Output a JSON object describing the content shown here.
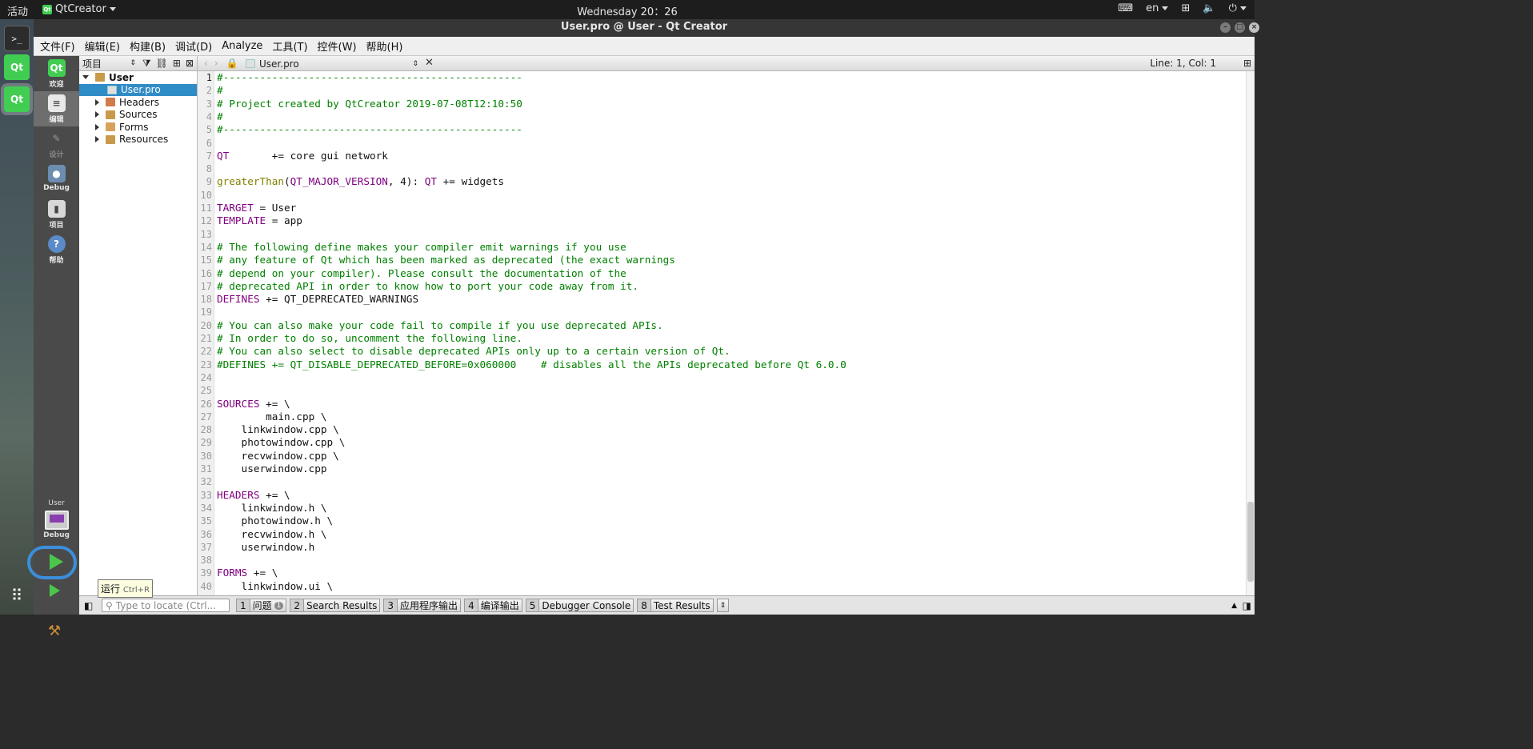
{
  "topbar": {
    "activities": "活动",
    "app_name": "QtCreator",
    "clock": "Wednesday 20：26",
    "lang": "en"
  },
  "window": {
    "title": "User.pro @ User - Qt Creator"
  },
  "menu": [
    "文件(F)",
    "编辑(E)",
    "构建(B)",
    "调试(D)",
    "Analyze",
    "工具(T)",
    "控件(W)",
    "帮助(H)"
  ],
  "modes": {
    "welcome": "欢迎",
    "edit": "编辑",
    "design": "设计",
    "debug": "Debug",
    "projects": "项目",
    "help": "帮助"
  },
  "kit": {
    "project": "User",
    "config": "Debug"
  },
  "tooltip": {
    "label": "运行",
    "shortcut": "Ctrl+R"
  },
  "project_pane": {
    "title": "项目",
    "root": "User",
    "items": [
      "User.pro",
      "Headers",
      "Sources",
      "Forms",
      "Resources"
    ]
  },
  "editor": {
    "file": "User.pro",
    "position": "Line: 1, Col: 1"
  },
  "code_lines": [
    "#-------------------------------------------------",
    "#",
    "# Project created by QtCreator 2019-07-08T12:10:50",
    "#",
    "#-------------------------------------------------",
    "",
    "QT       += core gui network",
    "",
    "greaterThan(QT_MAJOR_VERSION, 4): QT += widgets",
    "",
    "TARGET = User",
    "TEMPLATE = app",
    "",
    "# The following define makes your compiler emit warnings if you use",
    "# any feature of Qt which has been marked as deprecated (the exact warnings",
    "# depend on your compiler). Please consult the documentation of the",
    "# deprecated API in order to know how to port your code away from it.",
    "DEFINES += QT_DEPRECATED_WARNINGS",
    "",
    "# You can also make your code fail to compile if you use deprecated APIs.",
    "# In order to do so, uncomment the following line.",
    "# You can also select to disable deprecated APIs only up to a certain version of Qt.",
    "#DEFINES += QT_DISABLE_DEPRECATED_BEFORE=0x060000    # disables all the APIs deprecated before Qt 6.0.0",
    "",
    "",
    "SOURCES += \\",
    "        main.cpp \\",
    "    linkwindow.cpp \\",
    "    photowindow.cpp \\",
    "    recvwindow.cpp \\",
    "    userwindow.cpp",
    "",
    "HEADERS += \\",
    "    linkwindow.h \\",
    "    photowindow.h \\",
    "    recvwindow.h \\",
    "    userwindow.h",
    "",
    "FORMS += \\",
    "    linkwindow.ui \\"
  ],
  "output": {
    "locate_placeholder": "Type to locate (Ctrl...",
    "tabs": [
      {
        "n": "1",
        "label": "问题"
      },
      {
        "n": "2",
        "label": "Search Results"
      },
      {
        "n": "3",
        "label": "应用程序输出"
      },
      {
        "n": "4",
        "label": "编译输出"
      },
      {
        "n": "5",
        "label": "Debugger Console"
      },
      {
        "n": "8",
        "label": "Test Results"
      }
    ],
    "problems_badge": "1"
  },
  "colors": {
    "comment": "#008000",
    "keyword": "#800080",
    "function": "#808000",
    "selection": "#308cc6",
    "run_highlight": "#3b8edb"
  }
}
